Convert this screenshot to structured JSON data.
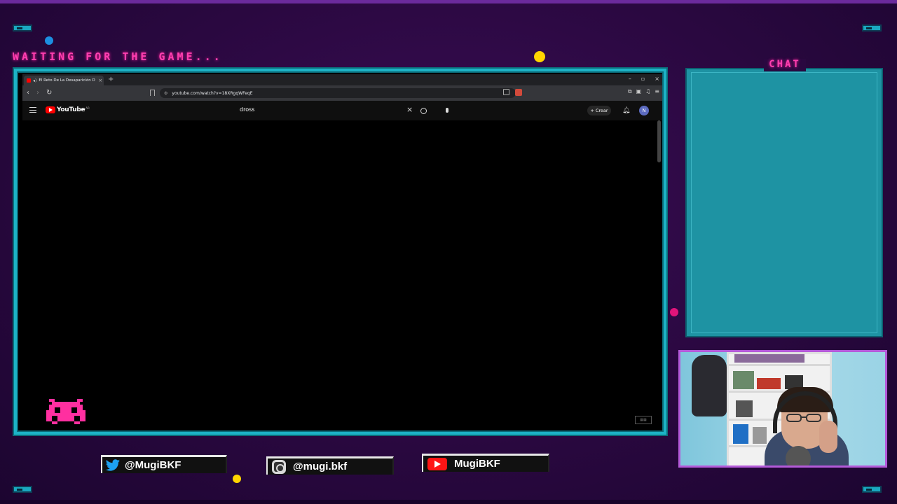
{
  "overlay": {
    "waiting_text": "WAITING FOR THE GAME...",
    "chat_title": "CHAT",
    "accent_pink": "#ff3fb0",
    "accent_cyan": "#1db3c6"
  },
  "browser": {
    "tab_title": "El Reto De La Desaparición D",
    "tab_close": "×",
    "new_tab": "+",
    "window_controls": [
      "–",
      "▫",
      "×"
    ],
    "url": "youtube.com/watch?v=18XRgqWFeqE"
  },
  "youtube": {
    "logo_text": "YouTube",
    "region": "AR",
    "search_value": "dross",
    "create_label": "Crear",
    "avatar_initial": "N"
  },
  "socials": {
    "twitter": "@MugiBKF",
    "instagram": "@mugi.bkf",
    "youtube": "MugiBKF"
  }
}
